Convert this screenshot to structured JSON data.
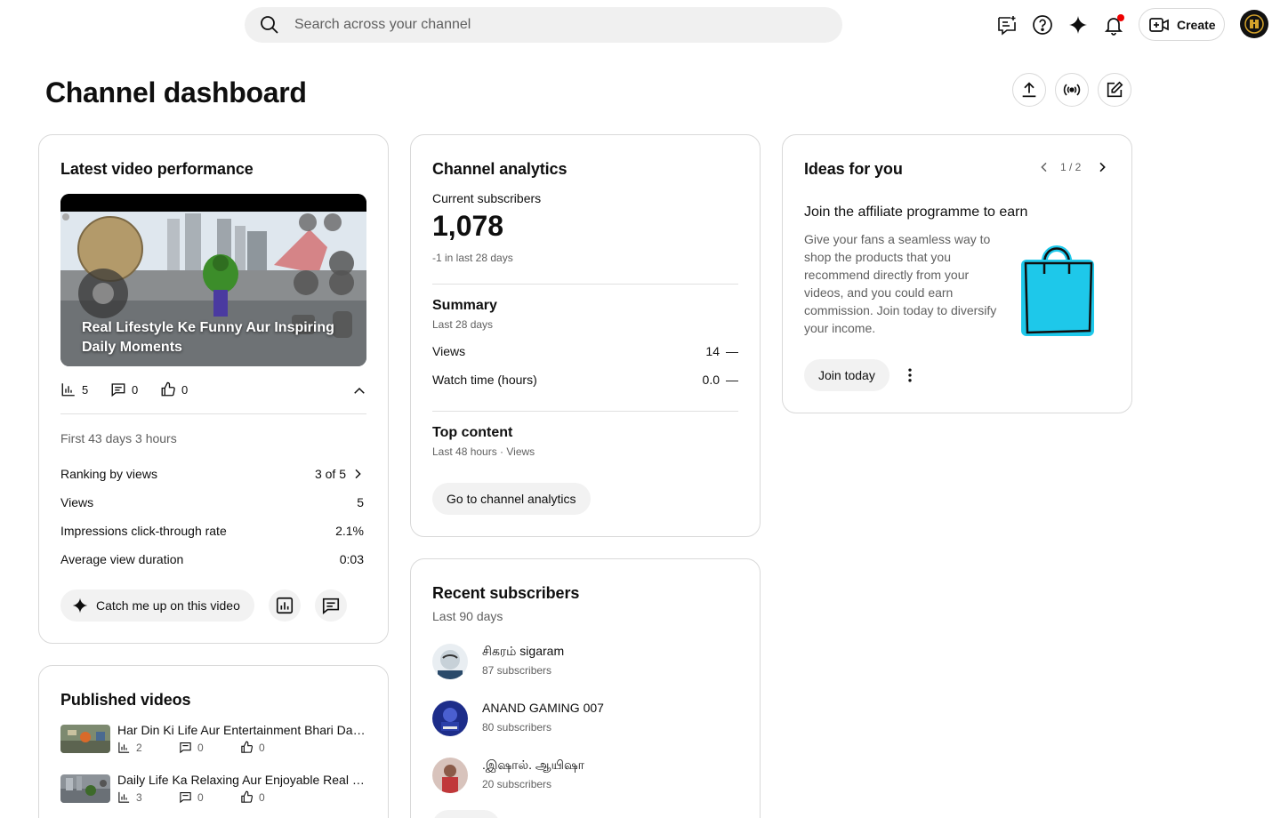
{
  "header": {
    "search_placeholder": "Search across your channel",
    "create_label": "Create",
    "icons": [
      "feedback-icon",
      "help-icon",
      "sparkle-icon",
      "bell-icon",
      "create-video-icon"
    ]
  },
  "page": {
    "title": "Channel dashboard",
    "actions": [
      "upload-icon",
      "live-icon",
      "edit-icon"
    ]
  },
  "latest_video": {
    "card_title": "Latest video performance",
    "thumbnail_title": "Real Lifestyle Ke Funny Aur Inspiring Daily Moments",
    "stats": {
      "views": "5",
      "comments": "0",
      "likes": "0"
    },
    "period": "First 43 days 3 hours",
    "rows": [
      {
        "label": "Ranking by views",
        "value": "3 of 5"
      },
      {
        "label": "Views",
        "value": "5"
      },
      {
        "label": "Impressions click-through rate",
        "value": "2.1%"
      },
      {
        "label": "Average view duration",
        "value": "0:03"
      }
    ],
    "catch_up_label": "Catch me up on this video"
  },
  "published_videos": {
    "card_title": "Published videos",
    "items": [
      {
        "title": "Har Din Ki Life Aur Entertainment Bhari Daily Moments",
        "views": "2",
        "comments": "0",
        "likes": "0"
      },
      {
        "title": "Daily Life Ka Relaxing Aur Enjoyable Real Routine",
        "views": "3",
        "comments": "0",
        "likes": "0"
      }
    ]
  },
  "channel_analytics": {
    "card_title": "Channel analytics",
    "subscribers_label": "Current subscribers",
    "subscribers_value": "1,078",
    "subscribers_change": "-1 in last 28 days",
    "summary_title": "Summary",
    "summary_period": "Last 28 days",
    "summary_rows": [
      {
        "label": "Views",
        "value": "14",
        "trend": "—"
      },
      {
        "label": "Watch time (hours)",
        "value": "0.0",
        "trend": "—"
      }
    ],
    "top_content_title": "Top content",
    "top_content_period": "Last 48 hours · Views",
    "button_label": "Go to channel analytics"
  },
  "recent_subscribers": {
    "card_title": "Recent subscribers",
    "period": "Last 90 days",
    "items": [
      {
        "name": "சிகரம் sigaram",
        "count": "87 subscribers"
      },
      {
        "name": "ANAND GAMING 007",
        "count": "80 subscribers"
      },
      {
        "name": ".இஷால். ஆயிஷா",
        "count": "20 subscribers"
      }
    ]
  },
  "ideas": {
    "card_title": "Ideas for you",
    "pager": "1 / 2",
    "heading": "Join the affiliate programme to earn",
    "body": "Give your fans a seamless way to shop the products that you recommend directly from your videos, and you could earn commission. Join today to diversify your income.",
    "button_label": "Join today"
  },
  "colors": {
    "accent_cyan": "#1ec8ea",
    "notification_dot": "#e00000",
    "pill_bg": "#f2f2f2"
  }
}
